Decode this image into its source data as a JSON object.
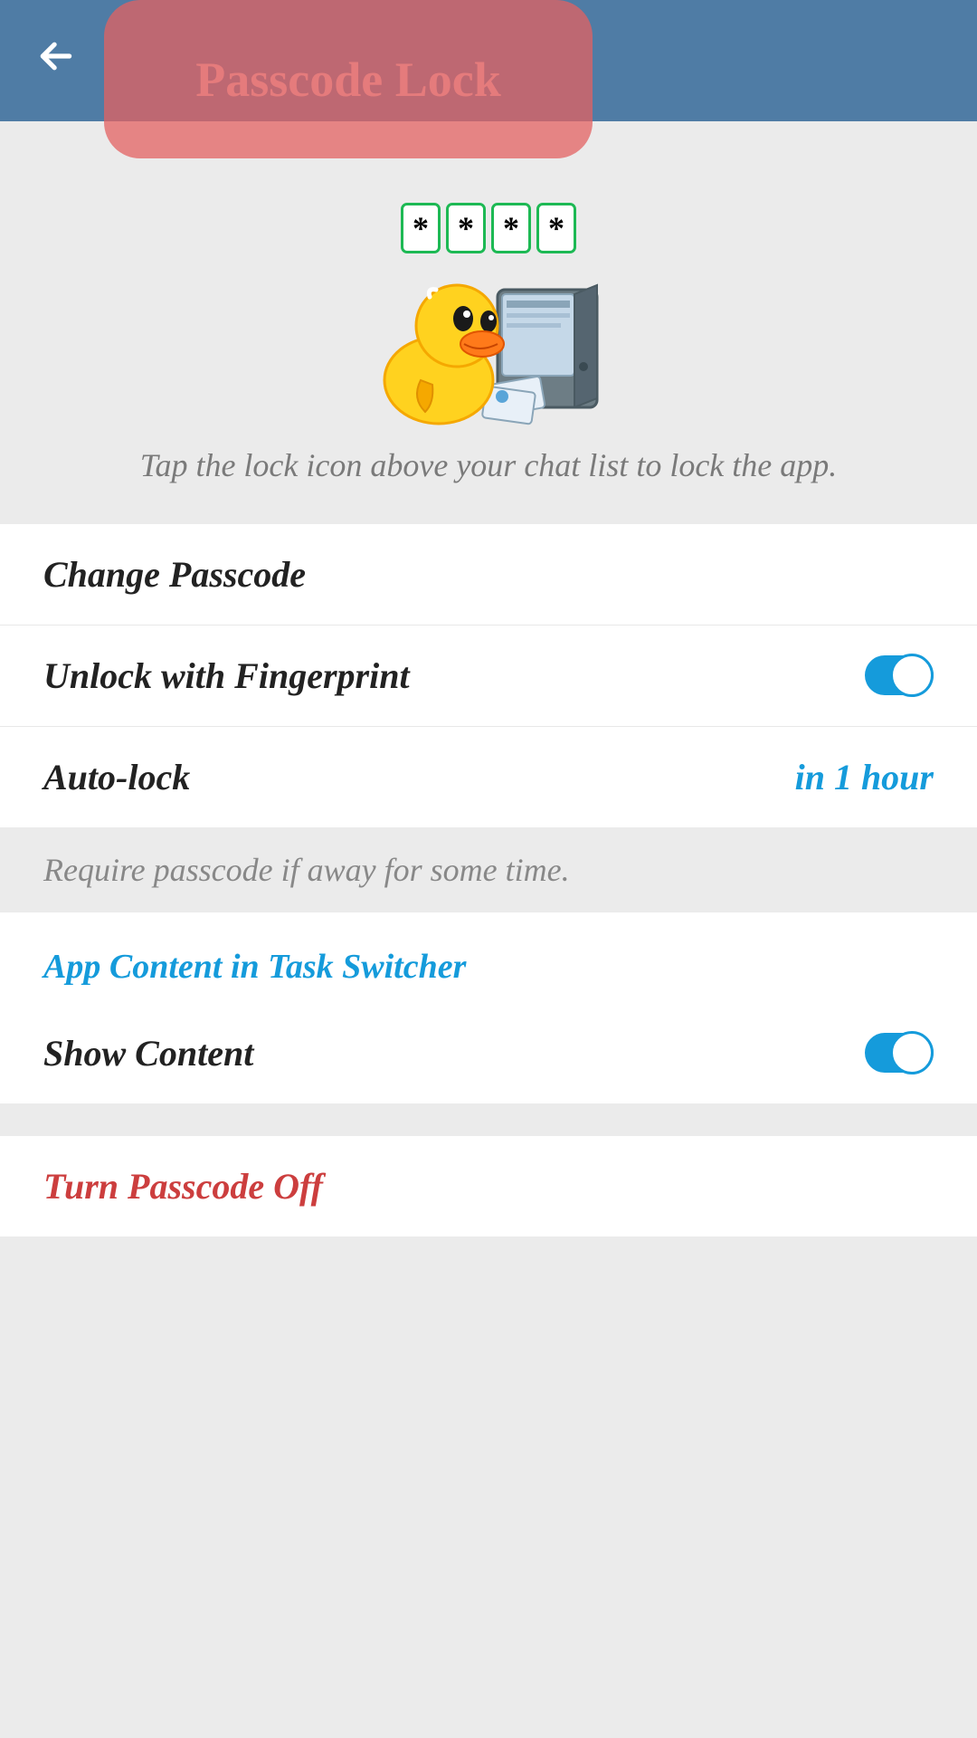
{
  "header": {
    "title": "Passcode Lock"
  },
  "hero": {
    "passcode_chars": [
      "*",
      "*",
      "*",
      "*"
    ],
    "description": "Tap the lock icon above your chat list to lock the app."
  },
  "settings": {
    "change_passcode": "Change Passcode",
    "unlock_fingerprint": "Unlock with Fingerprint",
    "unlock_fingerprint_enabled": true,
    "auto_lock": "Auto-lock",
    "auto_lock_value": "in 1 hour",
    "auto_lock_footer": "Require passcode if away for some time."
  },
  "task_switcher": {
    "section_title": "App Content in Task Switcher",
    "show_content": "Show Content",
    "show_content_enabled": true
  },
  "danger": {
    "turn_off": "Turn Passcode Off"
  }
}
